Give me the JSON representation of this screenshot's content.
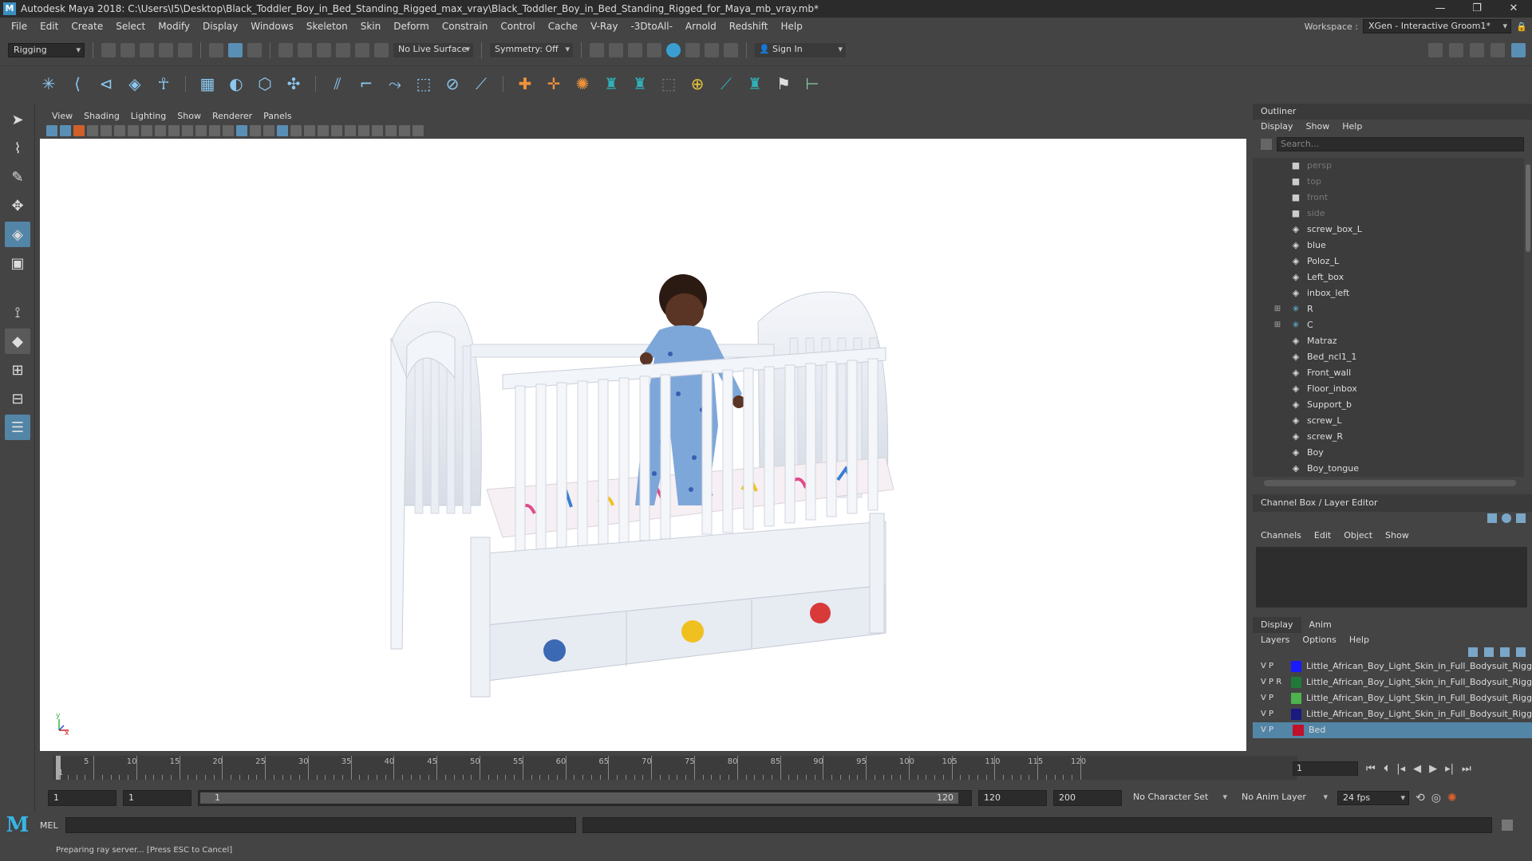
{
  "app": {
    "title": "Autodesk Maya 2018: C:\\Users\\I5\\Desktop\\Black_Toddler_Boy_in_Bed_Standing_Rigged_max_vray\\Black_Toddler_Boy_in_Bed_Standing_Rigged_for_Maya_mb_vray.mb*"
  },
  "menubar": {
    "items": [
      "File",
      "Edit",
      "Create",
      "Select",
      "Modify",
      "Display",
      "Windows",
      "Skeleton",
      "Skin",
      "Deform",
      "Constrain",
      "Control",
      "Cache",
      "V-Ray",
      "-3DtoAll-",
      "Arnold",
      "Redshift",
      "Help"
    ],
    "workspace_label": "Workspace :",
    "workspace_value": "XGen - Interactive Groom1*"
  },
  "statusline": {
    "mode": "Rigging",
    "live_surface": "No Live Surface",
    "symmetry": "Symmetry: Off",
    "sign_in": "Sign In"
  },
  "viewport": {
    "menus": [
      "View",
      "Shading",
      "Lighting",
      "Show",
      "Renderer",
      "Panels"
    ],
    "axis_x": "x",
    "axis_y": "y"
  },
  "outliner": {
    "title": "Outliner",
    "menus": [
      "Display",
      "Show",
      "Help"
    ],
    "search_placeholder": "Search...",
    "items": [
      {
        "name": "persp",
        "icon": "camera-icon",
        "dim": true
      },
      {
        "name": "top",
        "icon": "camera-icon",
        "dim": true
      },
      {
        "name": "front",
        "icon": "camera-icon",
        "dim": true
      },
      {
        "name": "side",
        "icon": "camera-icon",
        "dim": true
      },
      {
        "name": "screw_box_L",
        "icon": "mesh-icon"
      },
      {
        "name": "blue",
        "icon": "mesh-icon"
      },
      {
        "name": "Poloz_L",
        "icon": "mesh-icon"
      },
      {
        "name": "Left_box",
        "icon": "mesh-icon"
      },
      {
        "name": "inbox_left",
        "icon": "mesh-icon"
      },
      {
        "name": "R",
        "icon": "joint-icon",
        "expandable": true
      },
      {
        "name": "C",
        "icon": "joint-icon",
        "expandable": true
      },
      {
        "name": "Matraz",
        "icon": "mesh-icon"
      },
      {
        "name": "Bed_ncl1_1",
        "icon": "mesh-icon"
      },
      {
        "name": "Front_wall",
        "icon": "mesh-icon"
      },
      {
        "name": "Floor_inbox",
        "icon": "mesh-icon"
      },
      {
        "name": "Support_b",
        "icon": "mesh-icon"
      },
      {
        "name": "screw_L",
        "icon": "mesh-icon"
      },
      {
        "name": "screw_R",
        "icon": "mesh-icon"
      },
      {
        "name": "Boy",
        "icon": "mesh-icon"
      },
      {
        "name": "Boy_tongue",
        "icon": "mesh-icon"
      }
    ]
  },
  "channelbox": {
    "title": "Channel Box / Layer Editor",
    "menus": [
      "Channels",
      "Edit",
      "Object",
      "Show"
    ]
  },
  "layers": {
    "tabs": [
      "Display",
      "Anim"
    ],
    "menus": [
      "Layers",
      "Options",
      "Help"
    ],
    "rows": [
      {
        "flags": "V P",
        "name": "Little_African_Boy_Light_Skin_in_Full_Bodysuit_Rigg",
        "color": "#1a1aff"
      },
      {
        "flags": "V P R",
        "name": "Little_African_Boy_Light_Skin_in_Full_Bodysuit_Rigg",
        "color": "#1f7a3a"
      },
      {
        "flags": "V P",
        "name": "Little_African_Boy_Light_Skin_in_Full_Bodysuit_Rigg",
        "color": "#4db34d"
      },
      {
        "flags": "V P",
        "name": "Little_African_Boy_Light_Skin_in_Full_Bodysuit_Rigg",
        "color": "#1a1a80"
      },
      {
        "flags": "V P",
        "name": "Bed",
        "color": "#c0102a",
        "selected": true
      }
    ]
  },
  "timeline": {
    "ticks": [
      "5",
      "10",
      "15",
      "20",
      "25",
      "30",
      "35",
      "40",
      "45",
      "50",
      "55",
      "60",
      "65",
      "70",
      "75",
      "80",
      "85",
      "90",
      "95",
      "100",
      "105",
      "110",
      "115",
      "120"
    ],
    "current_marker": "1",
    "current_frame": "1"
  },
  "range": {
    "start": "1",
    "playback_start": "1",
    "slider_start": "1",
    "slider_end": "120",
    "playback_end": "120",
    "end": "200",
    "character_set": "No Character Set",
    "anim_layer": "No Anim Layer",
    "fps": "24 fps"
  },
  "cmdline": {
    "label": "MEL"
  },
  "helpline": {
    "text": "Preparing ray server... [Press ESC to Cancel]"
  }
}
